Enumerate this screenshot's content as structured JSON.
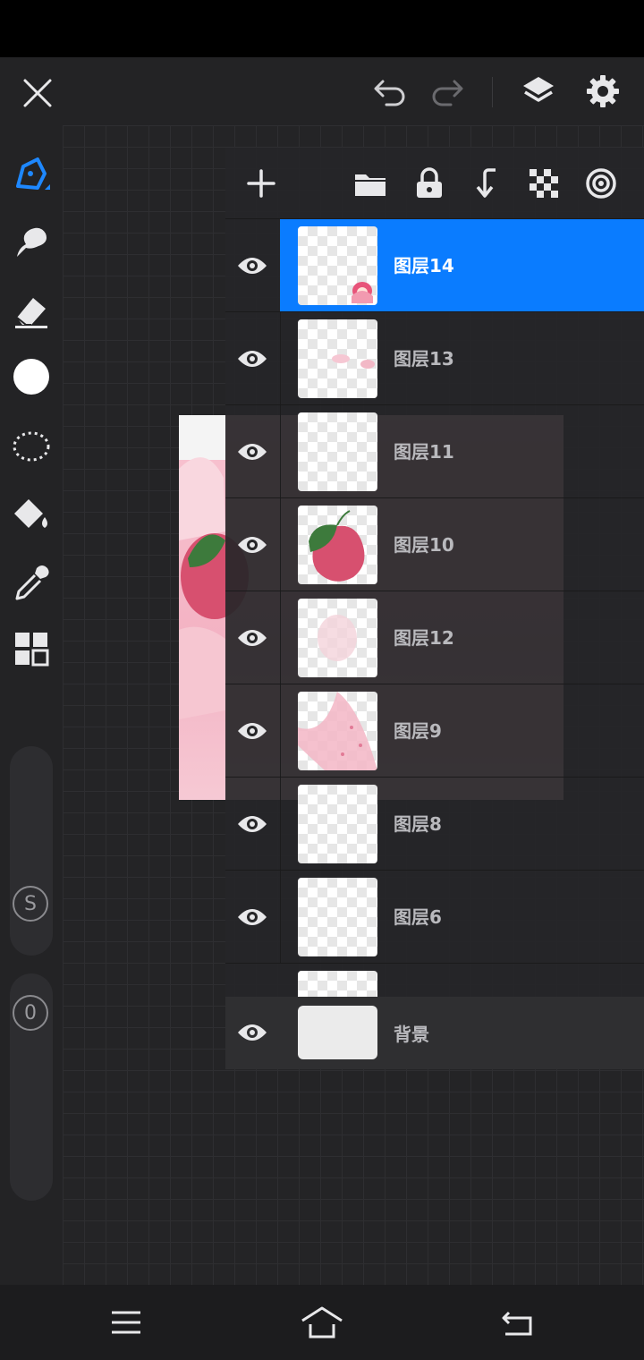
{
  "colors": {
    "accent": "#0a7cff",
    "active_tool": "#1e88ff",
    "icon": "#e8e8ea",
    "background": "#1f1f21"
  },
  "top_bar": {
    "icons": [
      "close-icon",
      "undo-icon",
      "redo-icon",
      "layers-icon",
      "settings-icon"
    ]
  },
  "toolbar": {
    "tools": [
      "brush-icon",
      "smudge-icon",
      "eraser-icon",
      "color-swatch",
      "lasso-icon",
      "fill-bucket-icon",
      "eyedropper-icon",
      "gallery-icon"
    ],
    "size_knob_label": "S",
    "opacity_knob_label": "0"
  },
  "layer_panel": {
    "toolbar_icons": [
      "add-layer-icon",
      "folder-icon",
      "lock-icon",
      "merge-down-icon",
      "transparency-icon",
      "blend-icon"
    ],
    "layers": [
      {
        "name": "图层14",
        "selected": true,
        "thumb": "girl-sticker"
      },
      {
        "name": "图层13",
        "selected": false,
        "thumb": "faint-pink"
      },
      {
        "name": "图层11",
        "selected": false,
        "thumb": "empty"
      },
      {
        "name": "图层10",
        "selected": false,
        "thumb": "apple"
      },
      {
        "name": "图层12",
        "selected": false,
        "thumb": "blur"
      },
      {
        "name": "图层9",
        "selected": false,
        "thumb": "speckles"
      },
      {
        "name": "图层8",
        "selected": false,
        "thumb": "empty"
      },
      {
        "name": "图层6",
        "selected": false,
        "thumb": "empty"
      }
    ],
    "background_layer": {
      "name": "背景"
    }
  },
  "nav_bar": {
    "icons": [
      "menu-icon",
      "home-icon",
      "back-icon"
    ]
  }
}
